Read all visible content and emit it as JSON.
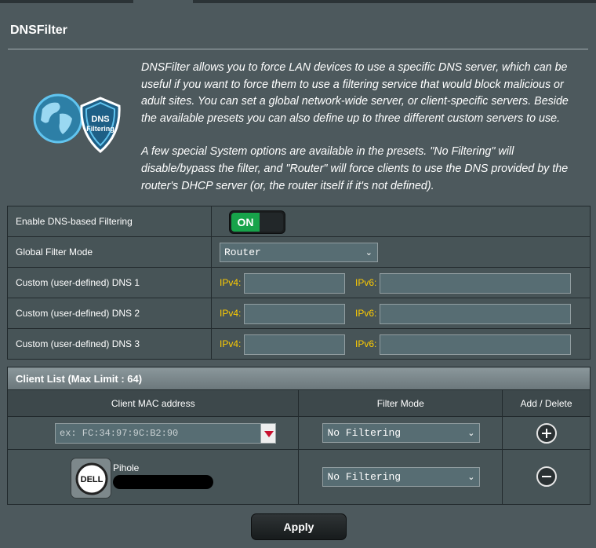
{
  "page": {
    "title": "DNSFilter",
    "description": [
      "DNSFilter allows you to force LAN devices to use a specific DNS server, which can be useful if you want to force them to use a filtering service that would block malicious or adult sites. You can set a global network-wide server, or client-specific servers. Beside the available presets you can also define up to three different custom servers to use.",
      "A few special System options are available in the presets. \"No Filtering\" will disable/bypass the filter, and \"Router\" will force clients to use the DNS provided by the router's DHCP server (or, the router itself if it's not defined)."
    ],
    "logo_text": [
      "DNS",
      "Filtering"
    ]
  },
  "settings": {
    "enable_label": "Enable DNS-based Filtering",
    "toggle_label": "ON",
    "global_mode_label": "Global Filter Mode",
    "global_mode_value": "Router",
    "dns_rows": [
      {
        "label": "Custom (user-defined) DNS 1",
        "ipv4_label": "IPv4:",
        "ipv6_label": "IPv6:",
        "ipv4": "",
        "ipv6": ""
      },
      {
        "label": "Custom (user-defined) DNS 2",
        "ipv4_label": "IPv4:",
        "ipv6_label": "IPv6:",
        "ipv4": "",
        "ipv6": ""
      },
      {
        "label": "Custom (user-defined) DNS 3",
        "ipv4_label": "IPv4:",
        "ipv6_label": "IPv6:",
        "ipv4": "",
        "ipv6": ""
      }
    ]
  },
  "client_list": {
    "header": "Client List (Max Limit : 64)",
    "columns": [
      "Client MAC address",
      "Filter Mode",
      "Add / Delete"
    ],
    "new_entry": {
      "mac_placeholder": "ex: FC:34:97:9C:B2:90",
      "filter_mode": "No Filtering"
    },
    "clients": [
      {
        "name": "Pihole",
        "icon_text": "DELL",
        "filter_mode": "No Filtering"
      }
    ]
  },
  "actions": {
    "apply_label": "Apply"
  },
  "colors": {
    "background": "#4d595d",
    "toggle_on": "#17a34a",
    "ip_label": "#ffcc00"
  }
}
